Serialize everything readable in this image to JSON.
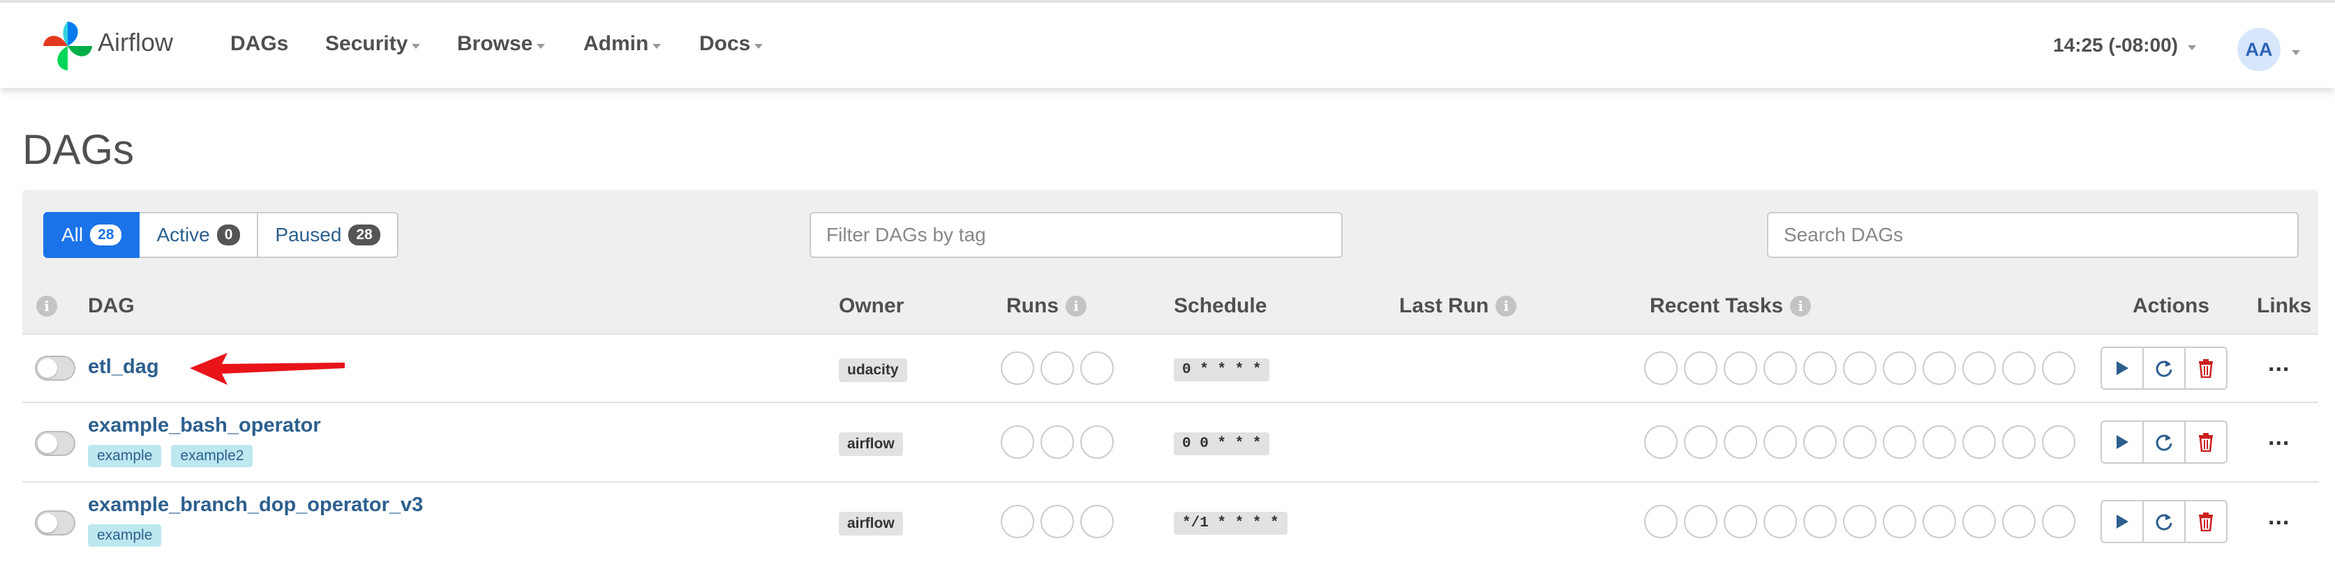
{
  "nav": {
    "brand": "Airflow",
    "items": [
      {
        "label": "DAGs",
        "caret": false
      },
      {
        "label": "Security",
        "caret": true
      },
      {
        "label": "Browse",
        "caret": true
      },
      {
        "label": "Admin",
        "caret": true
      },
      {
        "label": "Docs",
        "caret": true
      }
    ],
    "time": "14:25 (-08:00)",
    "user_initials": "AA"
  },
  "page": {
    "title": "DAGs"
  },
  "status_filter": [
    {
      "label": "All",
      "count": "28",
      "active": true
    },
    {
      "label": "Active",
      "count": "0",
      "active": false
    },
    {
      "label": "Paused",
      "count": "28",
      "active": false
    }
  ],
  "tag_filter": {
    "placeholder": "Filter DAGs by tag",
    "value": ""
  },
  "search": {
    "placeholder": "Search DAGs",
    "value": ""
  },
  "table": {
    "headers": {
      "dag": "DAG",
      "owner": "Owner",
      "runs": "Runs",
      "schedule": "Schedule",
      "last_run": "Last Run",
      "recent_tasks": "Recent Tasks",
      "actions": "Actions",
      "links": "Links"
    },
    "rows": [
      {
        "dag_id": "etl_dag",
        "tags": [],
        "owner": "udacity",
        "schedule": "0 * * * *",
        "paused": true,
        "last_run": ""
      },
      {
        "dag_id": "example_bash_operator",
        "tags": [
          "example",
          "example2"
        ],
        "owner": "airflow",
        "schedule": "0 0 * * *",
        "paused": true,
        "last_run": ""
      },
      {
        "dag_id": "example_branch_dop_operator_v3",
        "tags": [
          "example"
        ],
        "owner": "airflow",
        "schedule": "*/1 * * * *",
        "paused": true,
        "last_run": ""
      }
    ]
  },
  "icons": {
    "info": "info-icon",
    "trigger": "play-icon",
    "refresh": "refresh-icon",
    "delete": "trash-icon",
    "links": "more-dots-icon",
    "annotation": "red-arrow-icon"
  },
  "colors": {
    "accent": "#1a73e8",
    "link": "#2d5f8e",
    "delete": "#cc1f1f",
    "annotation": "#e8141a",
    "tag_bg": "#bde8f0"
  },
  "links_label": "..."
}
